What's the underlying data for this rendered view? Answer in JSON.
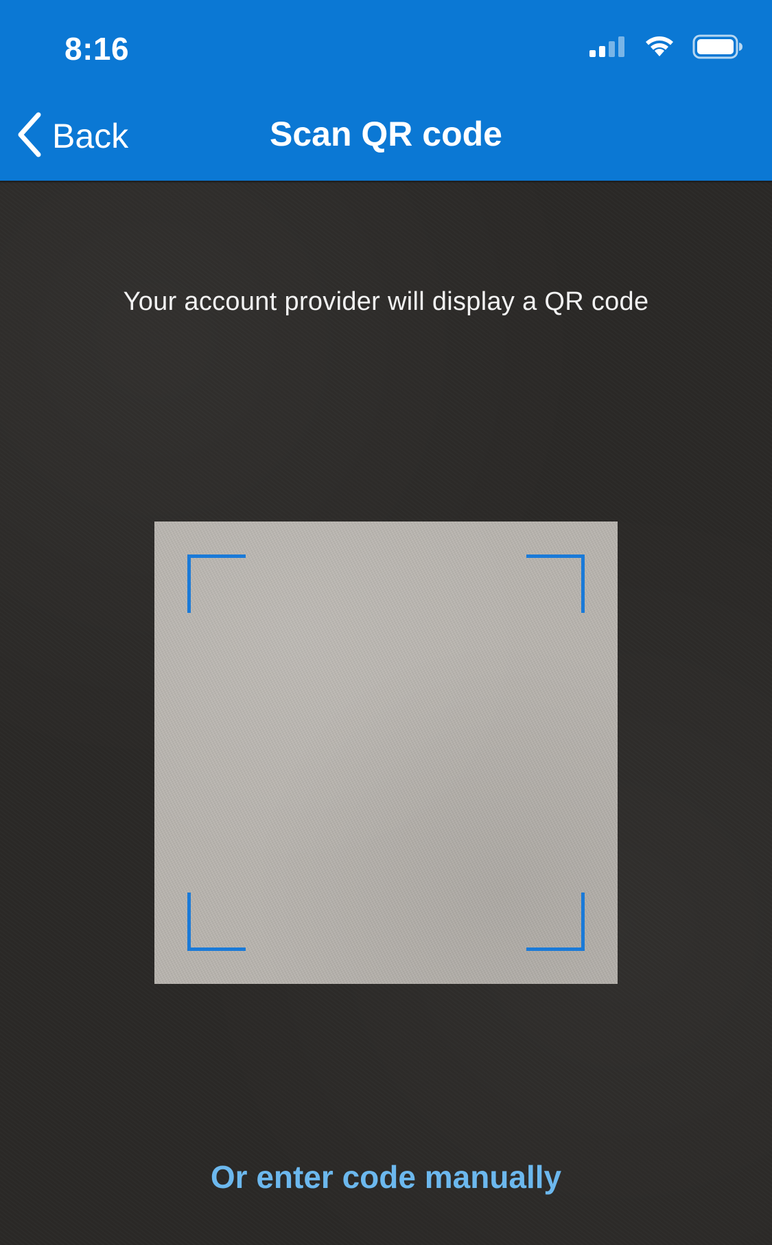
{
  "status_bar": {
    "time": "8:16",
    "icons": [
      "cellular-signal-icon",
      "wifi-icon",
      "battery-icon"
    ]
  },
  "nav": {
    "back_label": "Back",
    "back_icon": "chevron-left-icon",
    "title": "Scan QR code"
  },
  "scanner": {
    "instructions": "Your account provider will display a QR code",
    "frame_color": "#1a7ad8"
  },
  "manual_entry": {
    "label": "Or enter code manually"
  },
  "colors": {
    "header_background": "#0b78d4",
    "link": "#6cb8ee",
    "camera_background": "#2b2927"
  }
}
